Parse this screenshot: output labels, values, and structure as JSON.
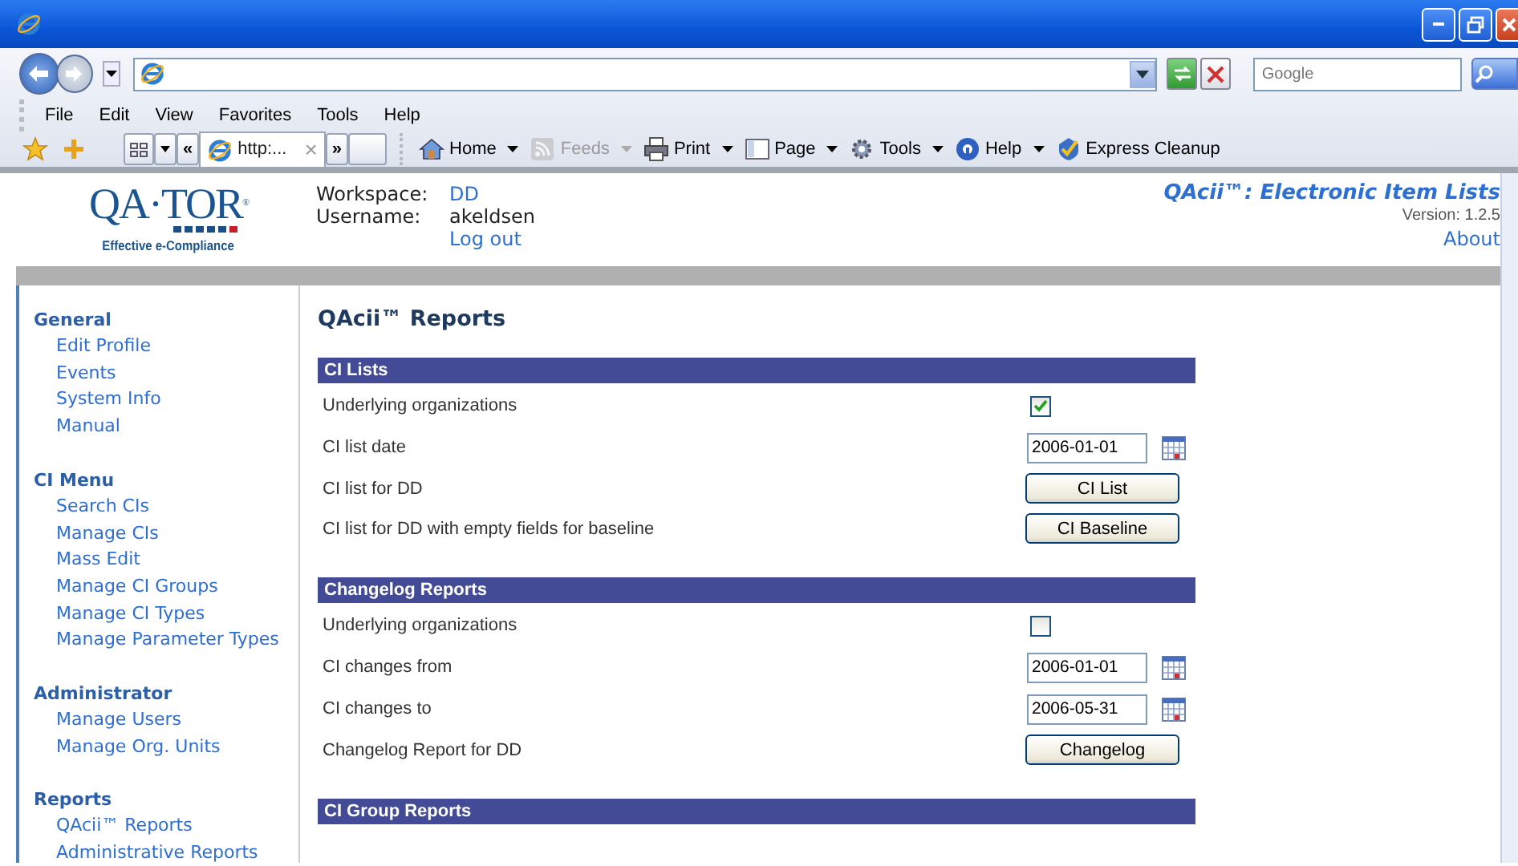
{
  "browser": {
    "search": {
      "placeholder": "Google"
    },
    "menu": [
      "File",
      "Edit",
      "View",
      "Favorites",
      "Tools",
      "Help"
    ],
    "tab": {
      "label": "http:...",
      "close": "×"
    },
    "tab_nav": {
      "back": "«",
      "forward": "»"
    },
    "commands": [
      {
        "kind": "home",
        "label": "Home",
        "dropdown": true,
        "disabled": false
      },
      {
        "kind": "feeds",
        "label": "Feeds",
        "dropdown": true,
        "disabled": true
      },
      {
        "kind": "print",
        "label": "Print",
        "dropdown": true,
        "disabled": false
      },
      {
        "kind": "page",
        "label": "Page",
        "dropdown": true,
        "disabled": false
      },
      {
        "kind": "tools",
        "label": "Tools",
        "dropdown": true,
        "disabled": false
      },
      {
        "kind": "help",
        "label": "Help",
        "dropdown": true,
        "disabled": false
      },
      {
        "kind": "cleanup",
        "label": "Express Cleanup",
        "dropdown": false,
        "disabled": false
      }
    ]
  },
  "header": {
    "logo": {
      "wordmark": "QA·TOR",
      "registered": "®",
      "tagline": "Effective e-Compliance"
    },
    "workspace": {
      "label": "Workspace:",
      "value": "DD"
    },
    "username": {
      "label": "Username:",
      "value": "akeldsen"
    },
    "logout": "Log out",
    "app_title": "QAcii™: Electronic Item Lists",
    "version": "Version: 1.2.5",
    "about": "About"
  },
  "sidebar": [
    {
      "title": "General",
      "items": [
        "Edit Profile",
        "Events",
        "System Info",
        "Manual"
      ]
    },
    {
      "title": "CI Menu",
      "items": [
        "Search CIs",
        "Manage CIs",
        "Mass Edit",
        "Manage CI Groups",
        "Manage CI Types",
        "Manage Parameter Types"
      ]
    },
    {
      "title": "Administrator",
      "items": [
        "Manage Users",
        "Manage Org. Units"
      ]
    },
    {
      "title": "Reports",
      "items": [
        "QAcii™ Reports",
        "Administrative Reports"
      ]
    }
  ],
  "main": {
    "heading": "QAcii™ Reports",
    "sections": [
      {
        "title": "CI Lists",
        "rows": [
          {
            "kind": "checkbox",
            "label": "Underlying organizations",
            "checked": true
          },
          {
            "kind": "date",
            "label": "CI list date",
            "value": "2006-01-01"
          },
          {
            "kind": "button",
            "label": "CI list for DD",
            "button": "CI List"
          },
          {
            "kind": "button",
            "label": "CI list for DD with empty fields for baseline",
            "button": "CI Baseline"
          }
        ]
      },
      {
        "title": "Changelog Reports",
        "rows": [
          {
            "kind": "checkbox",
            "label": "Underlying organizations",
            "checked": false
          },
          {
            "kind": "date",
            "label": "CI changes from",
            "value": "2006-01-01"
          },
          {
            "kind": "date",
            "label": "CI changes to",
            "value": "2006-05-31"
          },
          {
            "kind": "button",
            "label": "Changelog Report for DD",
            "button": "Changelog"
          }
        ]
      },
      {
        "title": "CI Group Reports"
      }
    ]
  }
}
